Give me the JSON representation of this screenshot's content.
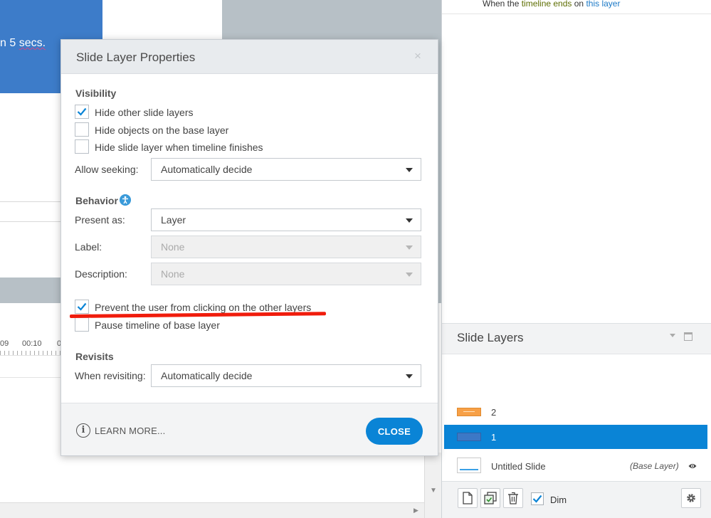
{
  "slide": {
    "caption_prefix": "n 5 ",
    "caption_word": "secs."
  },
  "timeline": {
    "ticks": [
      "09",
      "00:10",
      "0"
    ]
  },
  "trigger": {
    "prefix": "When the ",
    "kw1": "timeline ends",
    "mid": " on ",
    "kw2": "this layer"
  },
  "dialog": {
    "title": "Slide Layer Properties",
    "close_x": "×",
    "visibility": {
      "heading": "Visibility",
      "options": [
        {
          "label": "Hide other slide layers",
          "checked": true
        },
        {
          "label": "Hide objects on the base layer",
          "checked": false
        },
        {
          "label": "Hide slide layer when timeline finishes",
          "checked": false
        }
      ],
      "seek_label": "Allow seeking:",
      "seek_value": "Automatically decide"
    },
    "behavior": {
      "heading": "Behavior",
      "present_label": "Present as:",
      "present_value": "Layer",
      "label_label": "Label:",
      "label_value": "None",
      "desc_label": "Description:",
      "desc_value": "None",
      "options": [
        {
          "label": "Prevent the user from clicking on the other layers",
          "checked": true
        },
        {
          "label": "Pause timeline of base layer",
          "checked": false
        }
      ]
    },
    "revisits": {
      "heading": "Revisits",
      "when_label": "When revisiting:",
      "when_value": "Automatically decide"
    },
    "footer": {
      "learn_more": "LEARN MORE...",
      "close": "CLOSE"
    }
  },
  "layers_panel": {
    "title": "Slide Layers",
    "layers": [
      {
        "name": "2",
        "color": "#f7a047"
      },
      {
        "name": "1",
        "color": "#3c78c6",
        "selected": true
      }
    ],
    "base": {
      "name": "Untitled Slide",
      "tag": "(Base Layer)"
    },
    "dim_label": "Dim",
    "dim_checked": true
  },
  "colors": {
    "accent": "#0a84d6",
    "annotation_red": "#f01c0c"
  }
}
